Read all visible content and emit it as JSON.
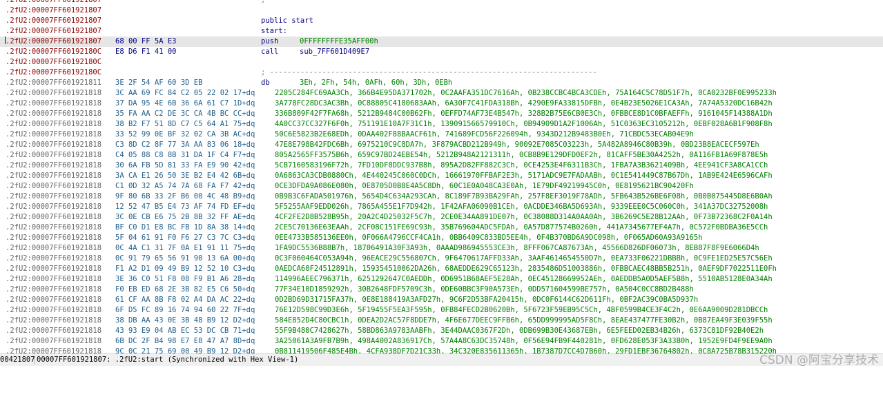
{
  "listing": [
    {
      "addr": ".2fU2:00007FF601921807",
      "kind": "code",
      "text": ";",
      "textKind": "sep"
    },
    {
      "addr": ".2fU2:00007FF601921807",
      "kind": "code"
    },
    {
      "addr": ".2fU2:00007FF601921807",
      "kind": "code",
      "text": "public start",
      "textKind": "label"
    },
    {
      "addr": ".2fU2:00007FF601921807",
      "kind": "code",
      "text": "start:",
      "textKind": "label"
    },
    {
      "addr": ".2fU2:00007FF601921807",
      "kind": "code",
      "bytes": "68 00 FF 5A E3",
      "mnemonic": "push",
      "operand": "0FFFFFFFFE35AFF00h",
      "opKind": "num",
      "selected": true
    },
    {
      "addr": ".2fU2:00007FF60192180C",
      "kind": "code",
      "bytes": "E8 D6 F1 41 00",
      "mnemonic": "call",
      "operand": "sub_7FF601D409E7",
      "opKind": "sym"
    },
    {
      "addr": ".2fU2:00007FF60192180C",
      "kind": "code"
    },
    {
      "addr": ".2fU2:00007FF60192180C",
      "kind": "code",
      "text": "; ---------------------------------------------------------------------------",
      "textKind": "sep"
    },
    {
      "addr": ".2fU2:00007FF601921811",
      "kind": "data",
      "bytes": "3E 2F 54 AF 60 3D EB",
      "mnemonic": "db",
      "operand": "3Eh, 2Fh, 54h, 0AFh, 60h, 3Dh, 0EBh",
      "opKind": "db"
    },
    {
      "addr": ".2fU2:00007FF601921818",
      "kind": "data",
      "bytes": "3C AA 69 FC 84 C2 05 22 02 17+dq",
      "dbvals": "2205C284FC69AA3Ch, 366B4E95DA371702h, 0C2AAFA351DC7616Ah, 0B238CCBC4BCA3CDEh, 75A164C5C78D51F7h, 0CA0232BF0E995233h"
    },
    {
      "addr": ".2fU2:00007FF601921818",
      "kind": "data",
      "bytes": "37 DA 95 4E 6B 36 6A 61 C7 1D+dq",
      "dbvals": "3A778FC28DC3AC3Bh, 0C88805C4180683AAh, 6A30F7C41FDA318Bh, 4290E9FA33815DFBh, 0E4B23E5026E1CA3Ah, 7A74A5320DC16B42h"
    },
    {
      "addr": ".2fU2:00007FF601921818",
      "kind": "data",
      "bytes": "35 FA AA C2 DE 3C CA 4B BC CC+dq",
      "dbvals": "336B809F42F7FA68h, 5212B9484C00B62Fh, 0EFFD74AF73E4B547h, 328B2B75E6CB0E3Ch, 0FBBCE8D1C0BFAEFFh, 9161045F14388A1Dh"
    },
    {
      "addr": ".2fU2:00007FF601921818",
      "kind": "data",
      "bytes": "38 B2 F7 51 8D C7 C5 64 A1 75+dq",
      "dbvals": "4A0CC37CC327F6F0h, 751191E10A7F31C1h, 139091566579910Ch, 0B94909D1A2F1006Ah, 51C0363EC3105212h, 0EBF028A6B1F908F8h"
    },
    {
      "addr": ".2fU2:00007FF601921818",
      "kind": "data",
      "bytes": "33 52 99 0E BF 32 02 CA 3B AC+dq",
      "dbvals": "50C6E5823B2E68EDh, 0DAA402F88BAACF61h, 741689FCD56F226094h, 9343D212B9483B0Eh, 71CBDC53ECAB04E9h"
    },
    {
      "addr": ".2fU2:00007FF601921818",
      "kind": "data",
      "bytes": "C3 8D C2 8F 77 3A AA 83 06 18+dq",
      "dbvals": "47E8E798B42FDC6Bh, 6975210C9C8DA7h, 3F879ACBD212B949h, 90092E7085C03223h, 5A482A8946C80B39h, 0BD23B8EACECF597Eh"
    },
    {
      "addr": ".2fU2:00007FF601921818",
      "kind": "data",
      "bytes": "C4 05 88 C8 8B 31 DA 1F C4 F7+dq",
      "dbvals": "805A2565FF3575B6h, 659C97BD24EBE54h, 5212B948A2121311h, 0CB8B9E129DFD0EF2h, 81CAFF5BE30A4252h, 0A116FB1A69F878E5h"
    },
    {
      "addr": ".2fU2:00007FF601921818",
      "kind": "data",
      "bytes": "30 6A FB 5D 81 33 FA E9 90 42+dq",
      "dbvals": "5CB7160583196F72h, 7FD10DF8DDC937B8h, 895A2D82FF882C3Ch, 0CE4253E4F6311B3Ch, 1FBA7A3B3621409Bh, 4EE941CF3A8CA1CCh"
    },
    {
      "addr": ".2fU2:00007FF601921818",
      "kind": "data",
      "bytes": "3A CA E1 26 50 3E B2 E4 42 6B+dq",
      "dbvals": "0A6863CA3CDB0880Ch, 4E440245C060C0DCh, 16661970FFBAF2E3h, 5171ADC9E7FADAABh, 0C1E541449C87B67Dh, 1AB9E424E6596CAFh"
    },
    {
      "addr": ".2fU2:00007FF601921818",
      "kind": "data",
      "bytes": "C1 0D 32 A5 74 7A 68 FA F7 42+dq",
      "dbvals": "0CE3DFDA9A086E080h, 0E8705D0B8E4A5C8Dh, 60C1E0A048CA3E0Ah, 1E79DF49219945C0h, 0E8195621BC90420Fh"
    },
    {
      "addr": ".2fU2:00007FF601921818",
      "kind": "data",
      "bytes": "9F 80 6B 33 2F B6 00 4C 48 B9+dq",
      "dbvals": "0B9B3C6FADA501976h, 5654D4C634A293CAh, 8C189F7B93BA29FAh, 257F8EF3019F78ADh, 5FB643B526BE6F08h, 0B0B075445D8E6B0Ah"
    },
    {
      "addr": ".2fU2:00007FF601921818",
      "kind": "data",
      "bytes": "12 52 47 B5 E4 73 AF 74 FD EF+dq",
      "dbvals": "5F5255AAF9EDD026h, 7865A455E1F7D942h, 1F42AFA06090B1CEh, 0ACDDE346BA5D693Ah, 9339EEE0C5C060C0h, 341A37DC32752008h"
    },
    {
      "addr": ".2fU2:00007FF601921818",
      "kind": "data",
      "bytes": "3C 0E CB E6 75 2B 8B 32 FF AE+dq",
      "dbvals": "4CF2FE2D8B528B95h, 20A2C4D25032F5C7h, 2CE0E34AA891DE07h, 0C38088D314A0AA0Ah, 3B6269C5E28B12AAh, 0F73B72368C2F0A14h"
    },
    {
      "addr": ".2fU2:00007FF601921818",
      "kind": "data",
      "bytes": "BF C0 D1 E8 BC FB 1D 8A 38 14+dq",
      "dbvals": "2CE5C70136E63EAAh, 2CF08C151FE69C93h, 35B769604ADC5FDAh, 0A57D877574B0260h, 441A7345677EF4A7h, 0C572F0BDBA36E5CCh"
    },
    {
      "addr": ".2fU2:00007FF601921818",
      "kind": "data",
      "bytes": "5F 04 61 91 F0 F6 27 C3 7C C3+dq",
      "dbvals": "0EE4733B585136EE0h, 0F066A4796CCF4CA1h, 0BB6409C833BD5EE4h, 0F4B370BD6A9DC098h, 0F065AD60A93A9165h"
    },
    {
      "addr": ".2fU2:00007FF601921818",
      "kind": "data",
      "bytes": "0C 4A C1 31 7F 0A E1 91 11 75+dq",
      "dbvals": "1FA9DC5536B88B7h, 18706491A30F3A93h, 0AAAD986945553CE3h, 8FFF067CA87673Ah, 45566D826DF06073h, 8EB87F8F9E6066D4h"
    },
    {
      "addr": ".2fU2:00007FF601921818",
      "kind": "data",
      "bytes": "0C 91 79 65 56 91 90 13 6A 00+dq",
      "dbvals": "0C3F060464C053A94h, 96EACE29C556807Ch, 9F6470617AFFD33Ah, 3AAF4614654550D7h, 0EA733F06221DBBBh, 0C9FE1ED25E57C56Eh"
    },
    {
      "addr": ".2fU2:00007FF601921818",
      "kind": "data",
      "bytes": "F1 A2 D1 09 49 B9 12 52 10 C3+dq",
      "dbvals": "0AEDCA60F24512891h, 159354510062DA26h, 68AEDDE629C65123h, 2835486D51003886h, 0FBBCAEC48BB5B251h, 0AEF9DF7022511E0Fh"
    },
    {
      "addr": ".2fU2:00007FF601921818",
      "kind": "data",
      "bytes": "3E 36 C0 51 F8 08 F9 B1 A6 28+dq",
      "dbvals": "114996AEEC796371h, 6251292647C0AEDDh, 0D6951B68AEF5E28Ah, 0EC45128669952AEh, 0AEDDB5A0D5AEF5B8h, 5510AB5128E0A34Ah"
    },
    {
      "addr": ".2fU2:00007FF601921818",
      "kind": "data",
      "bytes": "F0 EB ED 68 2E 3B 82 E5 C6 50+dq",
      "dbvals": "77F34E10D1859292h, 30B2648FDF5709C3h, 0DE60BBC3F90A573Eh, 0DD571604599BE757h, 0A504C0CC8BD2B488h"
    },
    {
      "addr": ".2fU2:00007FF601921818",
      "kind": "data",
      "bytes": "61 CF AA 8B F8 02 A4 DA AC 22+dq",
      "dbvals": "0D2BD69D31715FA37h, 0E8E188419A3AFD27h, 9C6F2D53BFA20415h, 0DC0F6144C62D611Fh, 0BF2AC39C0BA5D937h"
    },
    {
      "addr": ".2fU2:00007FF601921818",
      "kind": "data",
      "bytes": "6F D5 FC 89 16 74 94 60 22 7F+dq",
      "dbvals": "76E12D598C99D3E6h, 5F19455F5EA3F595h, 0FB84FECD2B0620Bh, 5F6723F59EB95C5Ch, 4BF0599B4CE3F4C2h, 0E6AA9009D281DBCCh"
    },
    {
      "addr": ".2fU2:00007FF601921818",
      "kind": "data",
      "bytes": "38 DB AA 43 0E 3B 48 B9 12 D2+dq",
      "dbvals": "584E852D4C80CBC1h, 0DEA2D2AC57F8DDE7h, 4F6E677DEEC9FFB6h, 65DD999995AD5F8Ch, 8EAE437477FE30B2h, 0B87EA49F3E039F55h"
    },
    {
      "addr": ".2fU2:00007FF601921818",
      "kind": "data",
      "bytes": "43 93 E9 04 AB EC 53 DC CB 71+dq",
      "dbvals": "55F9B480C7428627h, 58BD863A9783AABFh, 3E44DAAC0367F2Dh, 0DB699B30E43687EBh, 6E5FEED02EB34B26h, 6373C81DF92B40E2h"
    },
    {
      "addr": ".2fU2:00007FF601921818",
      "kind": "data",
      "bytes": "6B DC 2F B4 98 E7 E8 47 A7 8D+dq",
      "dbvals": "3A25061A3A9FB7B9h, 498A4002A836917Ch, 57A4A8C63DC35748h, 0F56E94FB9F440281h, 0FD628E053F3A33B0h, 1952E9FD4F9EE9A0h"
    },
    {
      "addr": ".2fU2:00007FF601921818",
      "kind": "data",
      "bytes": "9C 0C 21 75 69 00 49 B9 12 D2+dq",
      "dbvals": "0B811419506F485E4Bh, 4CFA938DF7D21C33h, 34C320E835611365h, 1B7387D7CC4D7B60h, 29FD1EBF36764802h, 0C8A725B78B315220h"
    }
  ],
  "status": {
    "offset": "00421807",
    "location": "00007FF601921807: .2fU2:start (Synchronized with Hex View-1)"
  },
  "watermark": "CSDN @阿宝分享技术"
}
